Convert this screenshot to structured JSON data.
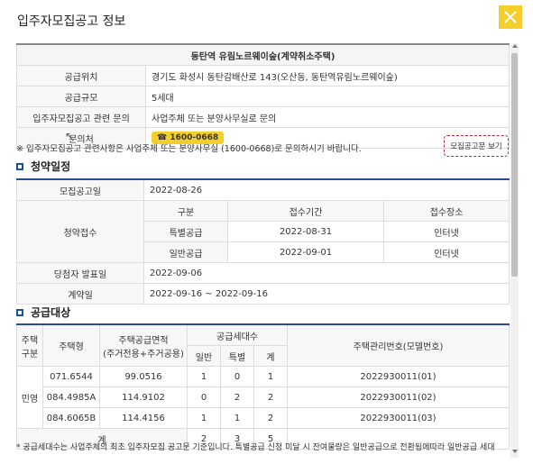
{
  "dialog": {
    "title": "입주자모집공고 정보"
  },
  "info": {
    "complex_name": "동탄역 유림노르웨이숲(계약취소주택)",
    "rows": [
      {
        "label": "공급위치",
        "value": "경기도 화성시 동탄감배산로 143(오산동, 동탄역유림노르웨이숲)"
      },
      {
        "label": "공급규모",
        "value": "5세대"
      },
      {
        "label": "입주자모집공고 관련 문의",
        "value": "사업주체 또는 분양사무실로 문의"
      },
      {
        "label": "문의처",
        "value": "☎ 1600-0668"
      }
    ],
    "note": "※ 입주자모집공고 관련사항은 사업주체 또는 분양사무실 (1600-0668)로 문의하시기 바랍니다.",
    "notice_button": "모집공고문 보기"
  },
  "schedule": {
    "section_title": "청약일정",
    "announce_label": "모집공고일",
    "announce_date": "2022-08-26",
    "apply_label": "청약접수",
    "headers": [
      "구분",
      "접수기간",
      "접수장소"
    ],
    "rows": [
      {
        "type": "특별공급",
        "date": "2022-08-31",
        "place": "인터넷"
      },
      {
        "type": "일반공급",
        "date": "2022-09-01",
        "place": "인터넷"
      }
    ],
    "winner_label": "당첨자 발표일",
    "winner_date": "2022-09-06",
    "contract_label": "계약일",
    "contract_date": "2022-09-16 ~ 2022-09-16"
  },
  "supply": {
    "section_title": "공급대상",
    "headers": {
      "house_type": "주택구분",
      "model": "주택형",
      "area": "주택공급면적",
      "area_sub": "(주거전용+주거공용)",
      "units": "공급세대수",
      "general": "일반",
      "special": "특별",
      "total": "계",
      "mgmt": "주택관리번호(모델번호)"
    },
    "house_type_value": "민영",
    "rows": [
      {
        "model": "071.6544",
        "area": "99.0516",
        "general": "1",
        "special": "0",
        "total": "1",
        "mgmt": "2022930011(01)"
      },
      {
        "model": "084.4985A",
        "area": "114.9102",
        "general": "0",
        "special": "2",
        "total": "2",
        "mgmt": "2022930011(02)"
      },
      {
        "model": "084.6065B",
        "area": "114.4156",
        "general": "1",
        "special": "1",
        "total": "2",
        "mgmt": "2022930011(03)"
      }
    ],
    "sum_label": "계",
    "sum": {
      "general": "2",
      "special": "3",
      "total": "5"
    }
  },
  "footnote": "* 공급세대수는 사업주체의 최초 입주자모집 공고문 기준입니다. 특별공급 신청 미달 시 잔여물량은 일반공급으로 전환됨에따라 일반공급 세대",
  "colors": {
    "accent_yellow": "#f4cf2b",
    "section_blue": "#1d4ea0",
    "notice_border": "#c0283a"
  }
}
